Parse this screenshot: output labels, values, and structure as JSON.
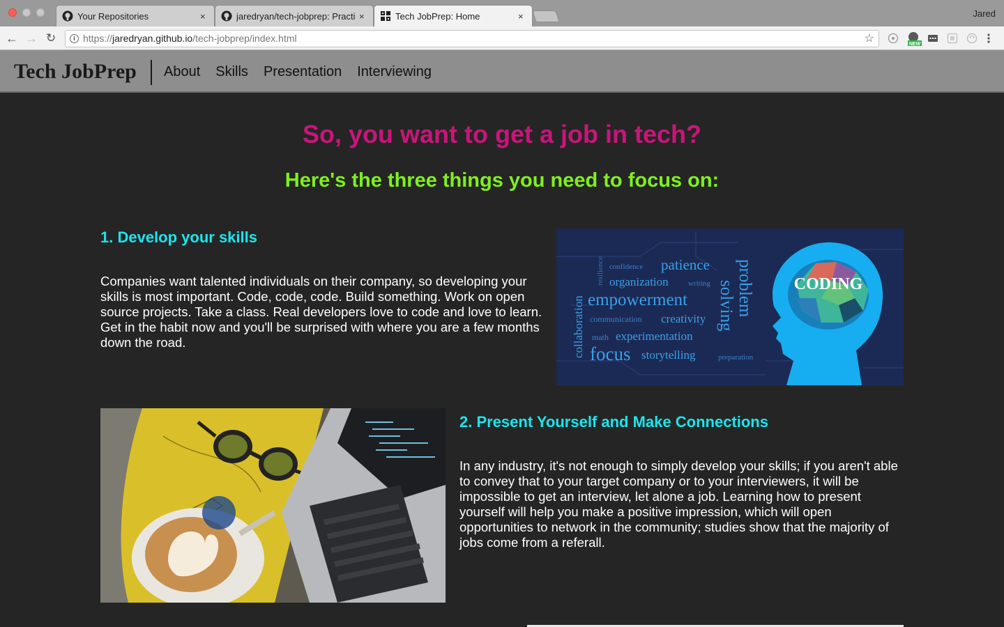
{
  "browser": {
    "tabs": [
      {
        "title": "Your Repositories",
        "icon": "github-icon"
      },
      {
        "title": "jaredryan/tech-jobprep: Practi",
        "icon": "github-icon"
      },
      {
        "title": "Tech JobPrep: Home",
        "icon": "site-grid-icon"
      }
    ],
    "tab_close": "×",
    "profile_name": "Jared",
    "url_scheme": "https://",
    "url_host": "jaredryan.github.io",
    "url_path": "/tech-jobprep/index.html",
    "ext_badge": "NEW"
  },
  "site": {
    "brand": "Tech JobPrep",
    "nav": [
      "About",
      "Skills",
      "Presentation",
      "Interviewing"
    ]
  },
  "main": {
    "heading": "So, you want to get a job in tech?",
    "subheading": "Here's the three things you need to focus on:",
    "section1": {
      "title": "1. Develop your skills",
      "body": "Companies want talented individuals on their company, so developing your skills is most important. Code, code, code. Build something. Work on open source projects. Take a class. Real developers love to code and love to learn. Get in the habit now and you'll be surprised with where you are a few months down the road."
    },
    "section2": {
      "title": "2. Present Yourself and Make Connections",
      "body": "In any industry, it's not enough to simply develop your skills; if you aren't able to convey that to your target company or to your interviewers, it will be impossible to get an interview, let alone a job. Learning how to present yourself will help you make a positive impression, which will open opportunities to network in the community; studies show that the majority of jobs come from a referall."
    },
    "wordcloud": {
      "coding": "CODING",
      "words": [
        "resilience",
        "confidence",
        "patience",
        "organization",
        "writing",
        "problem",
        "solving",
        "collaboration",
        "empowerment",
        "communication",
        "creativity",
        "math",
        "experimentation",
        "focus",
        "storytelling",
        "preparation"
      ]
    }
  },
  "colors": {
    "heading": "#c9157a",
    "subheading": "#7ff01c",
    "section_title": "#19e6ee",
    "page_bg": "#252525",
    "nav_bg": "#8e8e8e"
  }
}
